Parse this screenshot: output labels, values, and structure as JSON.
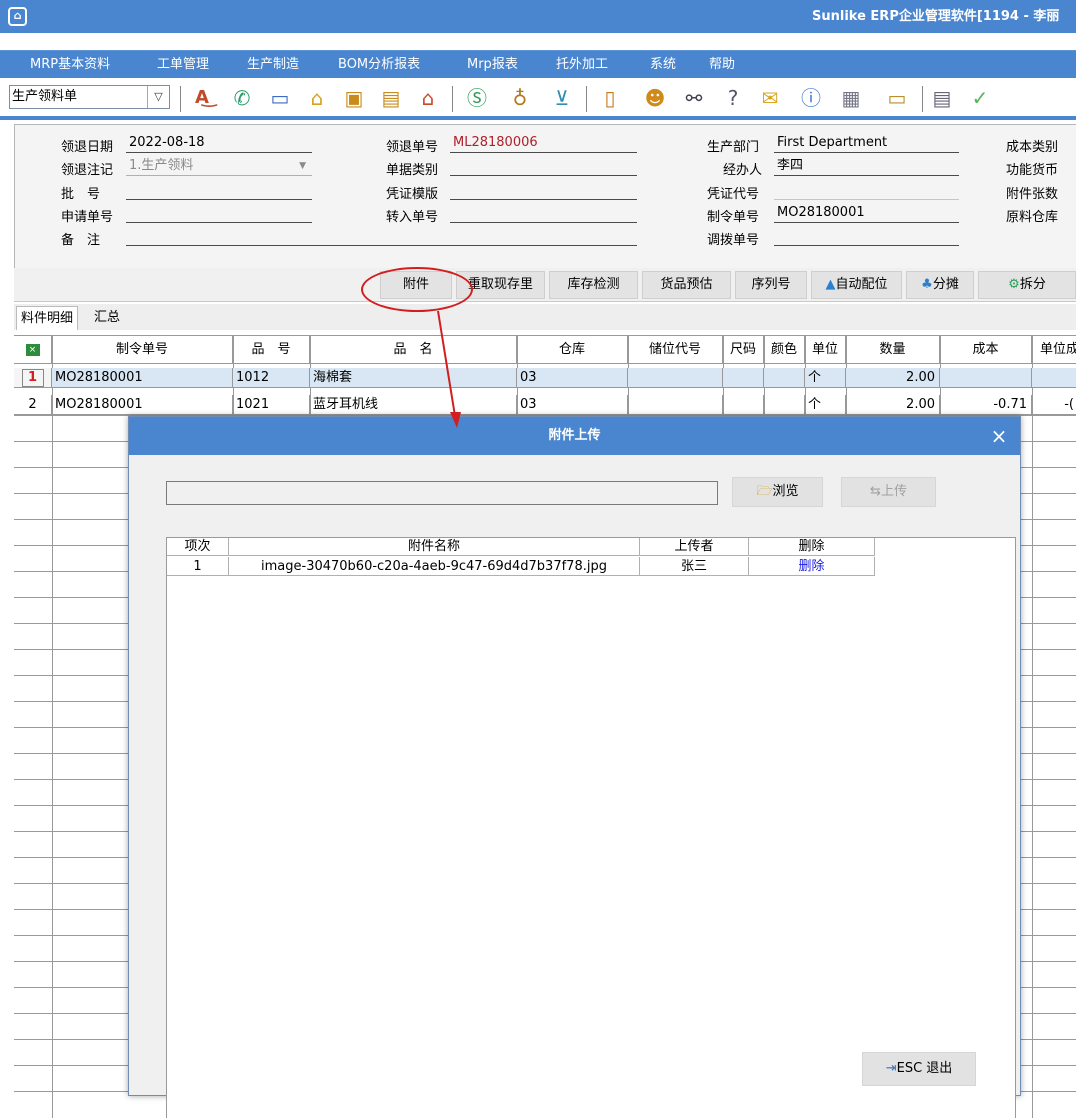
{
  "window": {
    "title": "Sunlike ERP企业管理软件[1194 - 李丽"
  },
  "menu": [
    "MRP基本资料",
    "工单管理",
    "生产制造",
    "BOM分析报表",
    "Mrp报表",
    "托外加工",
    "系统",
    "帮助"
  ],
  "toolbar": {
    "doc_type": "生产领料单",
    "icons": [
      "spellcheck-icon",
      "phone-icon",
      "monitor-icon",
      "lock-icon",
      "briefcase-icon",
      "home-icon",
      "dollar-icon",
      "money-bag-icon",
      "cart-icon",
      "clipboard-icon",
      "users-icon",
      "link-icon",
      "help-icon",
      "mail-icon",
      "info-icon",
      "calculator-icon",
      "folder-icon",
      "document-icon",
      "ok-icon"
    ]
  },
  "header": {
    "fields": {
      "date_label": "领退日期",
      "date_value": "2022-08-18",
      "note_label": "领退注记",
      "note_value": "1.生产领料",
      "batch_label": "批　号",
      "batch_value": "",
      "request_label": "申请单号",
      "request_value": "",
      "remark_label": "备　注",
      "remark_value": "",
      "order_no_label": "领退单号",
      "order_no_value": "ML28180006",
      "doc_class_label": "单据类别",
      "doc_class_value": "",
      "voucher_tpl_label": "凭证模版",
      "voucher_tpl_value": "",
      "transfer_in_label": "转入单号",
      "transfer_in_value": "",
      "dept_label": "生产部门",
      "dept_value": "First Department",
      "handler_label": "经办人",
      "handler_value": "李四",
      "voucher_code_label": "凭证代号",
      "voucher_code_value": "",
      "mo_no_label": "制令单号",
      "mo_no_value": "MO28180001",
      "transfer_no_label": "调拨单号",
      "transfer_no_value": "",
      "cost_type_label": "成本类别",
      "func_currency_label": "功能货币",
      "attach_count_label": "附件张数",
      "material_wh_label": "原料仓库"
    }
  },
  "action_buttons": {
    "attach": "附件",
    "refetch": "重取现存里",
    "stock_check": "库存检测",
    "goods_est": "货品预估",
    "serial": "序列号",
    "auto_alloc": "自动配位",
    "share": "分摊",
    "split": "拆分"
  },
  "tabs": {
    "detail": "料件明细",
    "summary": "汇总"
  },
  "grid": {
    "columns": [
      "制令单号",
      "品　号",
      "品　名",
      "仓库",
      "储位代号",
      "尺码",
      "颜色",
      "单位",
      "数量",
      "成本",
      "单位成"
    ],
    "rows": [
      {
        "idx": "1",
        "mo": "MO28180001",
        "part": "1012",
        "name": "海棉套",
        "wh": "03",
        "loc": "",
        "size": "",
        "color": "",
        "unit": "个",
        "qty": "2.00",
        "cost": "",
        "unit_cost": ""
      },
      {
        "idx": "2",
        "mo": "MO28180001",
        "part": "1021",
        "name": "蓝牙耳机线",
        "wh": "03",
        "loc": "",
        "size": "",
        "color": "",
        "unit": "个",
        "qty": "2.00",
        "cost": "-0.71",
        "unit_cost": "-("
      }
    ]
  },
  "dialog": {
    "title": "附件上传",
    "close": "×",
    "file_path": "",
    "browse": "浏览",
    "upload": "上传",
    "table": {
      "headers": [
        "项次",
        "附件名称",
        "上传者",
        "删除"
      ],
      "rows": [
        {
          "idx": "1",
          "filename": "image-30470b60-c20a-4aeb-9c47-69d4d7b37f78.jpg",
          "uploader": "张三",
          "delete": "删除"
        }
      ]
    },
    "exit": "ESC 退出"
  }
}
